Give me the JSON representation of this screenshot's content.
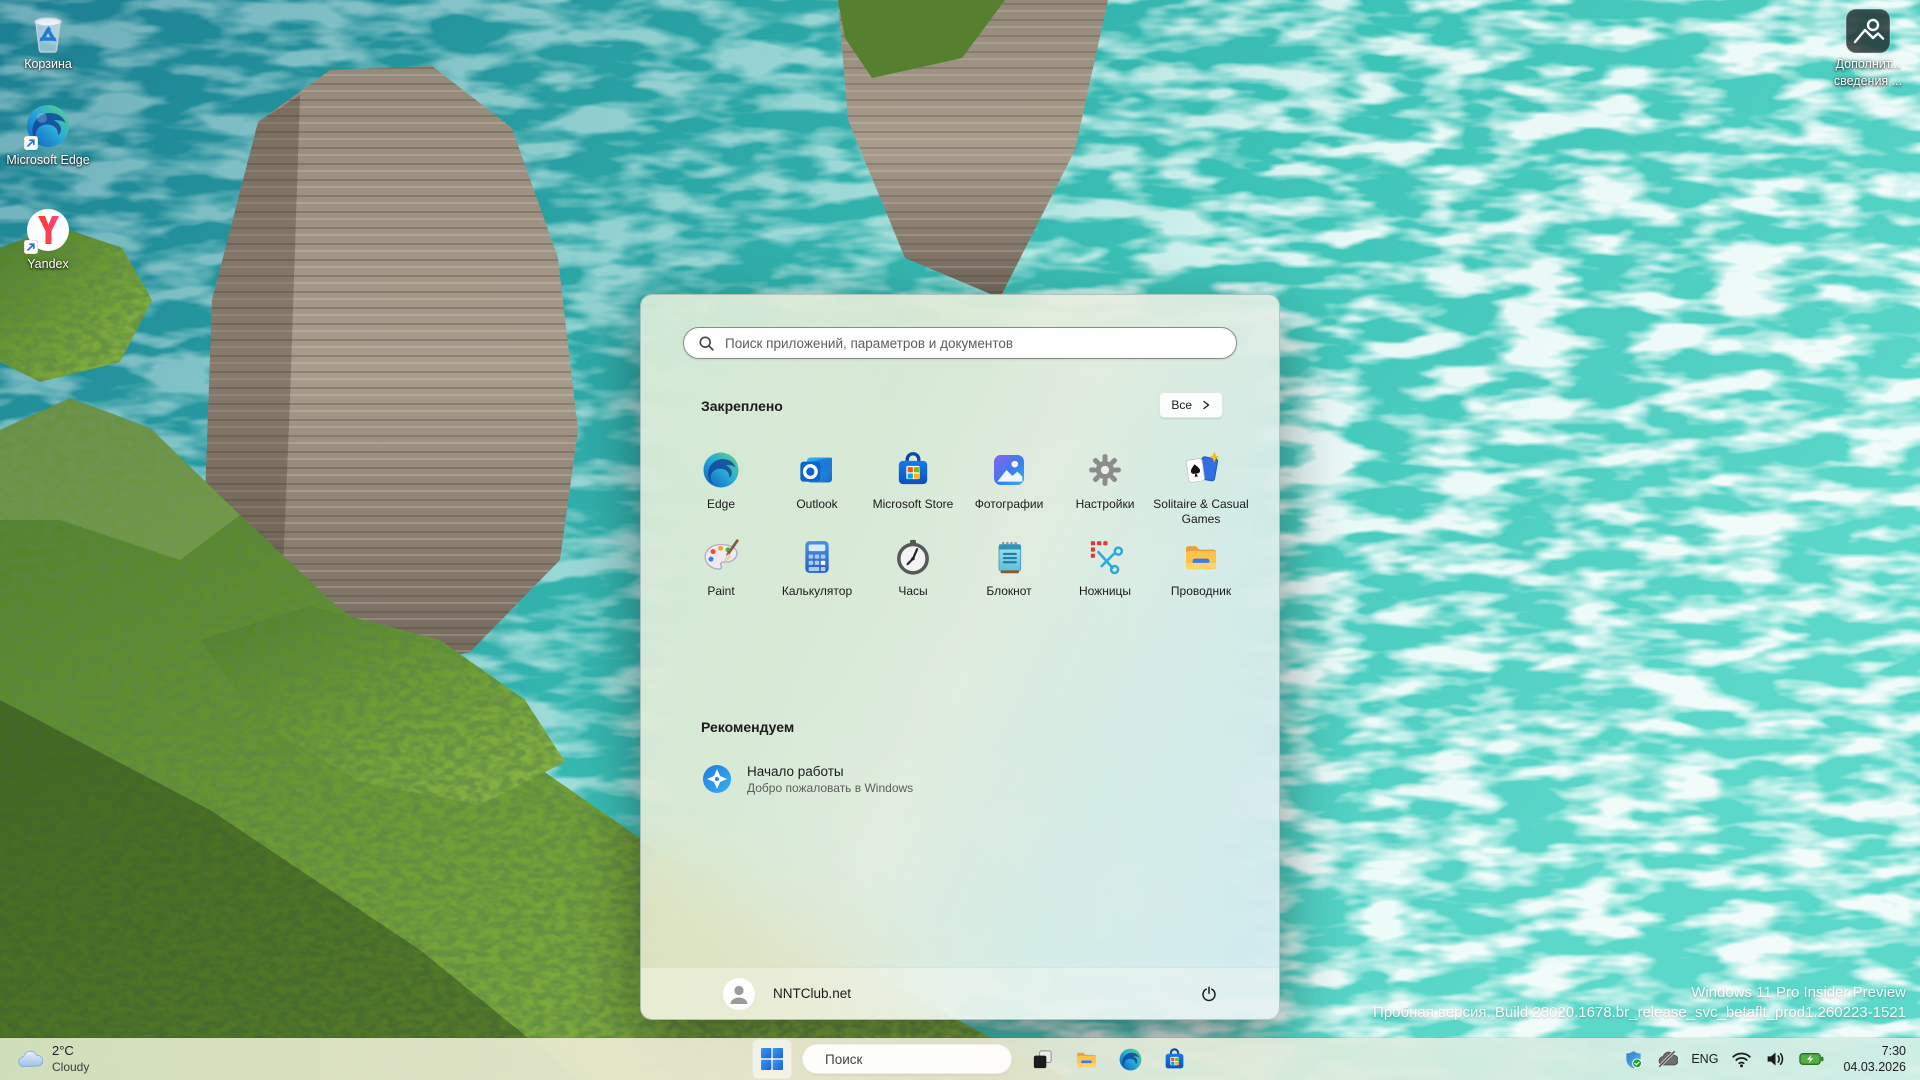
{
  "desktop": {
    "icons": [
      {
        "label": "Корзина"
      },
      {
        "label": "Microsoft Edge"
      },
      {
        "label": "Yandex"
      }
    ],
    "spotlight_label_line1": "Дополнит...",
    "spotlight_label_line2": "сведения ...",
    "watermark_line1": "Windows 11 Pro Insider Preview",
    "watermark_line2": "Пробная версия. Build 28020.1678.br_release_svc_betaflt_prod1.260223-1521"
  },
  "start_menu": {
    "search_placeholder": "Поиск приложений, параметров и документов",
    "pinned_title": "Закреплено",
    "all_button_label": "Все",
    "apps": [
      {
        "label": "Edge"
      },
      {
        "label": "Outlook"
      },
      {
        "label": "Microsoft Store"
      },
      {
        "label": "Фотографии"
      },
      {
        "label": "Настройки"
      },
      {
        "label": "Solitaire & Casual Games"
      },
      {
        "label": "Paint"
      },
      {
        "label": "Калькулятор"
      },
      {
        "label": "Часы"
      },
      {
        "label": "Блокнот"
      },
      {
        "label": "Ножницы"
      },
      {
        "label": "Проводник"
      }
    ],
    "recommended_title": "Рекомендуем",
    "recommended_item": {
      "title": "Начало работы",
      "subtitle": "Добро пожаловать в Windows"
    },
    "user_name": "NNTClub.net"
  },
  "taskbar": {
    "weather_temp": "2°C",
    "weather_condition": "Cloudy",
    "search_placeholder": "Поиск",
    "tray_language": "ENG",
    "clock_time": "7:30",
    "clock_date": "04.03.2026"
  },
  "colors": {
    "accent_blue": "#1b74e0",
    "water_teal": "#3cc2b7",
    "taskbar_tint": "#eef0d6"
  }
}
